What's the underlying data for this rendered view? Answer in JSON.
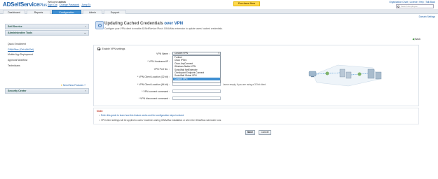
{
  "app": {
    "logo_text": "ADSelfService",
    "logo_plus": "Plus"
  },
  "header": {
    "welcome_label": "Welcome",
    "user": "admin",
    "links": [
      "Sign Out",
      "Change Password",
      "Jump To"
    ],
    "purchase_label": "Purchase Now",
    "top_links": "Organization Chart | License | Help | Talk Back",
    "search_placeholder": "Search Employee",
    "domain_settings": "Domain Settings"
  },
  "nav": {
    "tabs": [
      "Dashboard",
      "Reports",
      "Configuration",
      "Admin",
      "Support"
    ],
    "active_tab": "Configuration"
  },
  "sidebar": {
    "sections": [
      {
        "title": "Self-Service"
      },
      {
        "title": "Administrative Tools"
      }
    ],
    "items": [
      "Quick Enrollment",
      "GINA/Mac (Ctrl+Alt+Del)",
      "Mobile App Deployment",
      "Approval Workflow",
      "Technicians"
    ],
    "active_item": "GINA/Mac (Ctrl+Alt+Del)",
    "security_center": "Security Center",
    "need_features": "Need New Features ?"
  },
  "main": {
    "title": "Updating Cached Credentials",
    "title_highlight": "over VPN",
    "description": "Configure your VPN client to enable ADSelfService Plus's GINA/Mac extension to update users' cached credentials.",
    "back": "Back",
    "enable_label": "Enable VPN settings",
    "fields": {
      "vpn_name_label": "VPN Name :",
      "vpn_host_label": "* VPN Hostname/IP :",
      "vpn_port_label": "VPN Port No. :",
      "client_32_label": "* VPN Client Location (32 bit) :",
      "client_64_label": "* VPN Client Location (64 bit) :",
      "connect_label": "* VPN connect command :",
      "disconnect_label": "* VPN disconnect command :"
    },
    "vpn_selected": "Custom VPN",
    "vpn_options": [
      "Fortinet",
      "Cisco IPSec",
      "Cisco AnyConnect",
      "Windows Native VPN",
      "SonicWall NetExtender",
      "Checkpoint Endpoint Connect",
      "SonicWall Global VPN",
      "Custom VPN"
    ],
    "hint_64": "Leave empty, if you are using a 32 bit client.",
    "note_title": "Note:",
    "note_lines": [
      "Refer this guide to learn how this feature works and the configuration steps involved.",
      "VPN client settings will be applied to users' machines during GINA/Mac installation or when the GINA/Mac scheduler runs."
    ],
    "note_link": "this guide",
    "save": "Save",
    "cancel": "Cancel"
  }
}
